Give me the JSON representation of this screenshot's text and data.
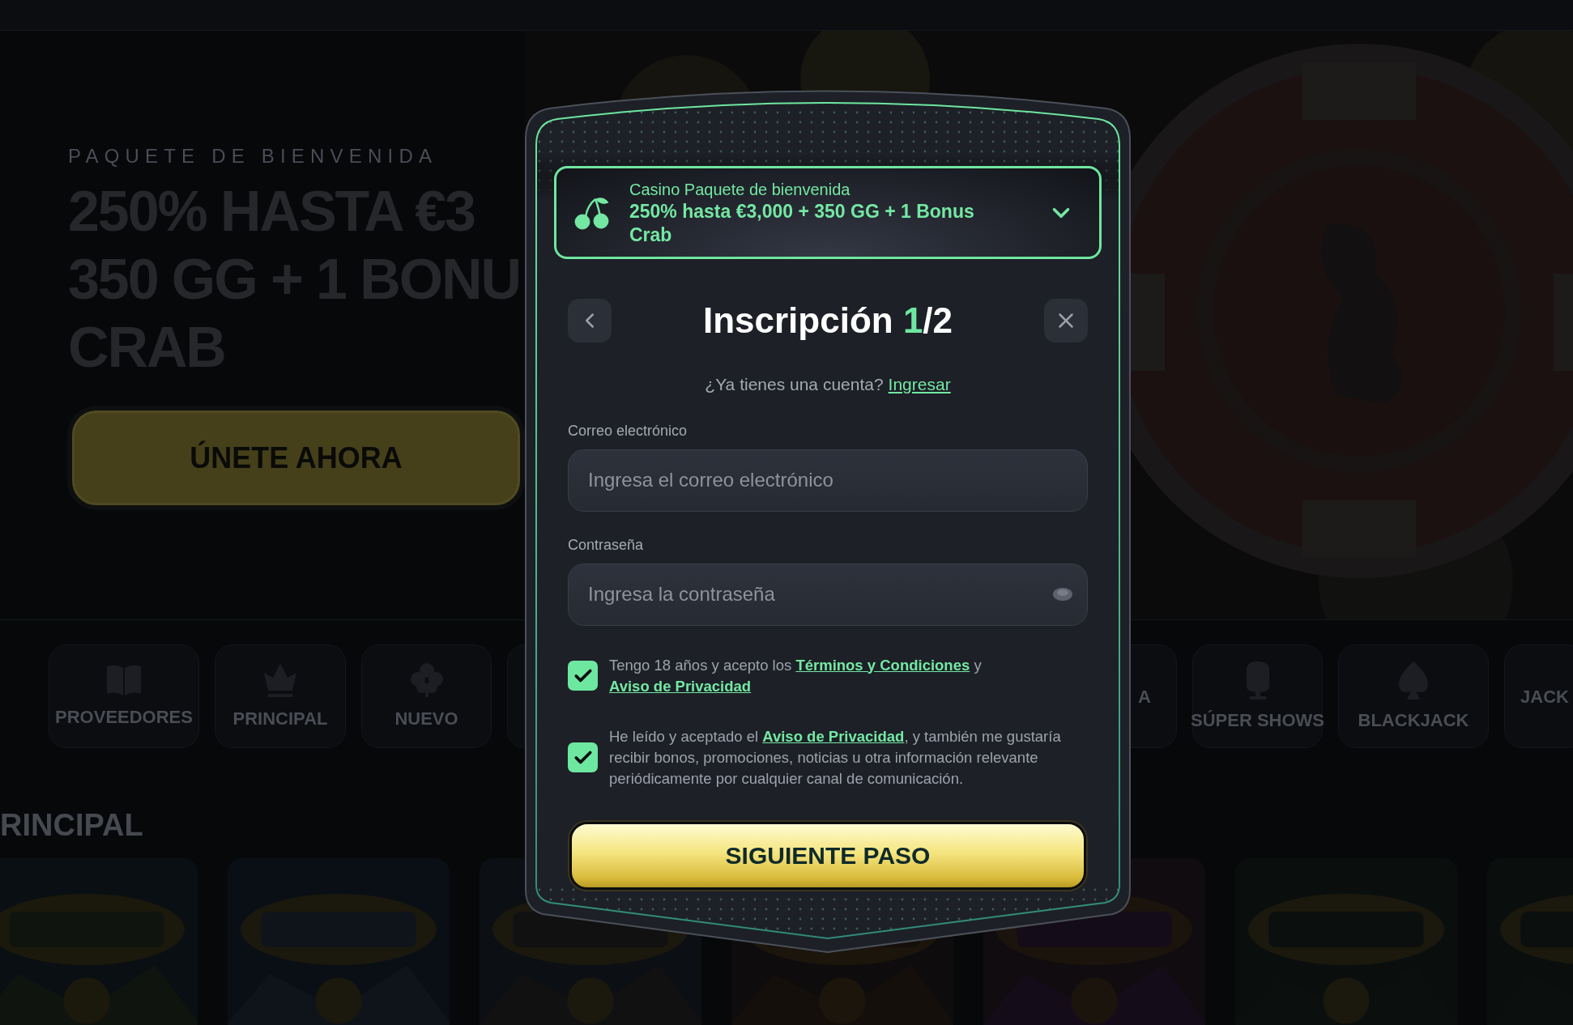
{
  "hero": {
    "eyebrow": "PAQUETE DE BIENVENIDA",
    "headline_lines": [
      "250% HASTA €3",
      "350 GG + 1 BONU",
      "CRAB"
    ],
    "cta": "ÚNETE AHORA"
  },
  "categories": [
    {
      "label": "PROVEEDORES"
    },
    {
      "label": "PRINCIPAL"
    },
    {
      "label": "NUEVO"
    },
    {
      "kind": "hidden"
    },
    {
      "label": "A"
    },
    {
      "label": "SÚPER SHOWS"
    },
    {
      "label": "BLACKJACK"
    },
    {
      "label": "JACK"
    }
  ],
  "section_title": "RINCIPAL",
  "modal": {
    "promo": {
      "title": "Casino Paquete de bienvenida",
      "offer": "250% hasta €3,000 + 350 GG + 1 Bonus Crab"
    },
    "title": "Inscripción",
    "step_current": "1",
    "step_total": "/2",
    "login_prompt": "¿Ya tienes una cuenta?",
    "login_link": "Ingresar",
    "fields": [
      {
        "label": "Correo electrónico",
        "placeholder": "Ingresa el correo electrónico",
        "kind": "email"
      },
      {
        "label": "Contraseña",
        "placeholder": "Ingresa la contraseña",
        "kind": "password"
      }
    ],
    "consents": [
      {
        "checked": true,
        "segments": [
          {
            "kind": "text",
            "text": "Tengo 18 años y acepto los "
          },
          {
            "kind": "link",
            "text": "Términos y Condiciones"
          },
          {
            "kind": "text",
            "text": " y "
          },
          {
            "kind": "link",
            "text": "Aviso de Privacidad"
          }
        ]
      },
      {
        "checked": true,
        "segments": [
          {
            "kind": "text",
            "text": "He leído y aceptado el "
          },
          {
            "kind": "link",
            "text": "Aviso de Privacidad"
          },
          {
            "kind": "text",
            "text": ", y también me gustaría recibir bonos, promociones, noticias u otra información relevante periódicamente por cualquier canal de comunicación."
          }
        ]
      }
    ],
    "submit": "SIGUIENTE PASO"
  }
}
